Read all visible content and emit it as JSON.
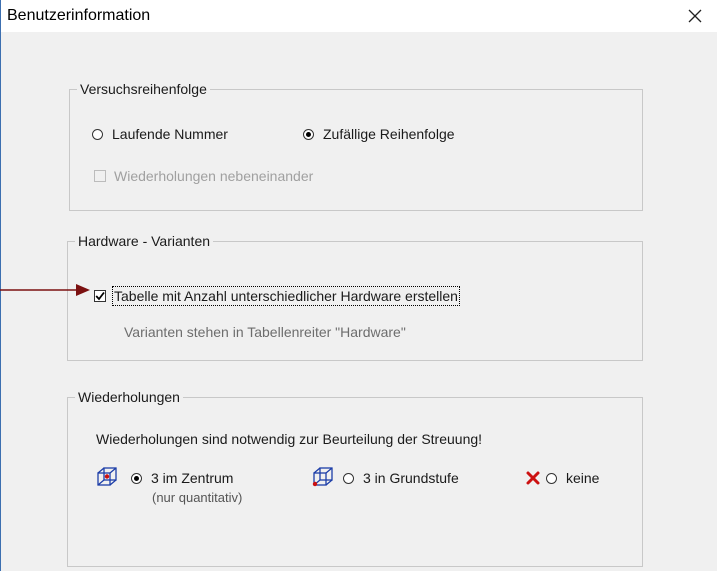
{
  "window": {
    "title": "Benutzerinformation"
  },
  "groups": {
    "order": {
      "legend": "Versuchsreihenfolge",
      "radio_running": "Laufende Nummer",
      "radio_random": "Zufällige Reihenfolge",
      "check_repeats": "Wiederholungen nebeneinander"
    },
    "hardware": {
      "legend": "Hardware - Varianten",
      "check_table": "Tabelle mit Anzahl unterschiedlicher Hardware erstellen",
      "note": "Varianten stehen in Tabellenreiter \"Hardware\""
    },
    "repeats": {
      "legend": "Wiederholungen",
      "info": "Wiederholungen sind notwendig zur Beurteilung der Streuung!",
      "opt_center": "3 im Zentrum",
      "opt_center_sub": "(nur quantitativ)",
      "opt_base": "3 in Grundstufe",
      "opt_none": "keine"
    }
  },
  "colors": {
    "arrow": "#7b1010",
    "accent_blue": "#1d3ea8",
    "red_x": "#cc1111"
  }
}
